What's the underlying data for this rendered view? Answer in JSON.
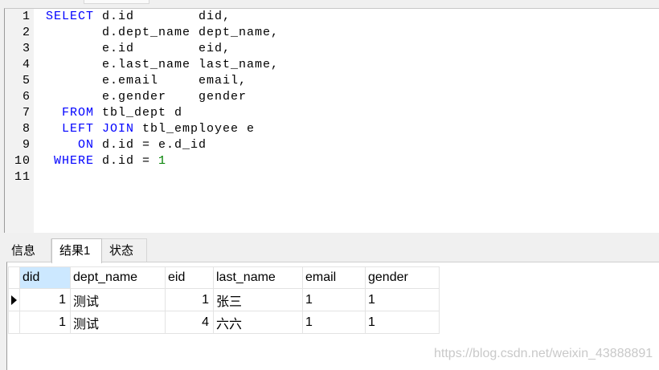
{
  "editor": {
    "lines": [
      {
        "num": "1",
        "tokens": [
          {
            "keyword": "SELECT"
          },
          {
            "text": " d.id        did,"
          }
        ]
      },
      {
        "num": "2",
        "tokens": [
          {
            "text": "       d.dept_name dept_name,"
          }
        ]
      },
      {
        "num": "3",
        "tokens": [
          {
            "text": "       e.id        eid,"
          }
        ]
      },
      {
        "num": "4",
        "tokens": [
          {
            "text": "       e.last_name last_name,"
          }
        ]
      },
      {
        "num": "5",
        "tokens": [
          {
            "text": "       e.email     email,"
          }
        ]
      },
      {
        "num": "6",
        "tokens": [
          {
            "text": "       e.gender    gender"
          }
        ]
      },
      {
        "num": "7",
        "tokens": [
          {
            "text": "  "
          },
          {
            "keyword": "FROM"
          },
          {
            "text": " tbl_dept d"
          }
        ]
      },
      {
        "num": "8",
        "tokens": [
          {
            "text": "  "
          },
          {
            "keyword": "LEFT JOIN"
          },
          {
            "text": " tbl_employee e"
          }
        ]
      },
      {
        "num": "9",
        "tokens": [
          {
            "text": "    "
          },
          {
            "keyword": "ON"
          },
          {
            "text": " d.id = e.d_id"
          }
        ]
      },
      {
        "num": "10",
        "tokens": [
          {
            "text": " "
          },
          {
            "keyword": "WHERE"
          },
          {
            "text": " d.id = "
          },
          {
            "number": "1"
          }
        ]
      },
      {
        "num": "11",
        "tokens": []
      }
    ]
  },
  "result_tabs": [
    {
      "label": "信息",
      "selected": false
    },
    {
      "label": "结果1",
      "selected": true
    },
    {
      "label": "状态",
      "selected": false
    }
  ],
  "grid": {
    "columns": [
      "did",
      "dept_name",
      "eid",
      "last_name",
      "email",
      "gender"
    ],
    "highlighted_column_index": 0,
    "current_row_index": 0,
    "rows": [
      [
        "1",
        "测试",
        "1",
        "张三",
        "1",
        "1"
      ],
      [
        "1",
        "测试",
        "4",
        "六六",
        "1",
        "1"
      ]
    ]
  },
  "watermark": "https://blog.csdn.net/weixin_43888891",
  "colors": {
    "keyword": "#0000ff",
    "number": "#008000",
    "plain": "#000000",
    "highlighted_header": "#cce8ff"
  }
}
